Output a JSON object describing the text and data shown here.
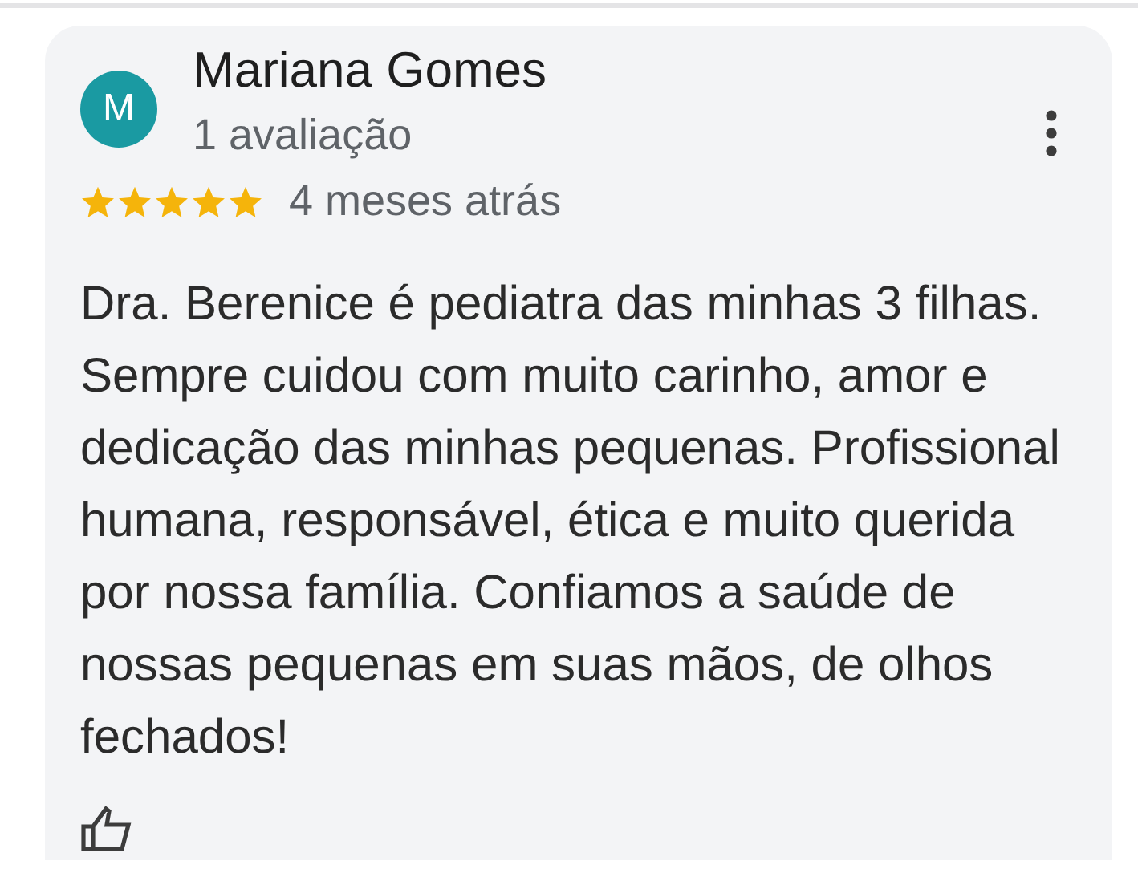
{
  "review": {
    "avatar_letter": "M",
    "author": "Mariana Gomes",
    "review_count": "1 avaliação",
    "stars": 5,
    "time": "4 meses atrás",
    "text": "Dra. Berenice é pediatra das minhas 3 filhas. Sempre cuidou com muito carinho, amor e dedicação das minhas pequenas. Profissional humana, responsável, ética e muito querida por nossa família. Confiamos a saúde de nossas pequenas em suas mãos, de olhos fechados!"
  }
}
